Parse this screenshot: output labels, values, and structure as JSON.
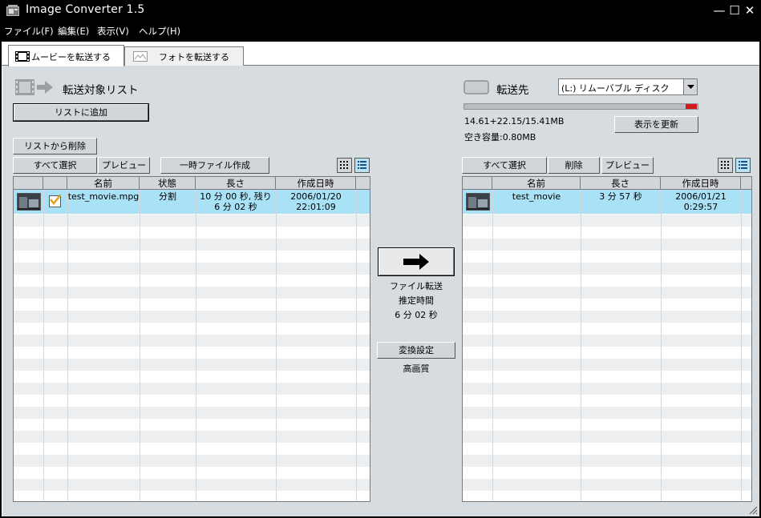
{
  "window": {
    "title": "Image Converter 1.5",
    "controls": {
      "minimize": "—",
      "maximize": "☐",
      "close": "✕"
    }
  },
  "menu": [
    "ファイル(F)",
    "編集(E)",
    "表示(V)",
    "ヘルプ(H)"
  ],
  "tabs": [
    {
      "label": "ムービーを転送する",
      "icon": "film-icon",
      "active": true
    },
    {
      "label": "フォトを転送する",
      "icon": "photo-icon",
      "active": false
    }
  ],
  "source": {
    "heading": "転送対象リスト",
    "add_button": "リストに追加",
    "remove_button": "リストから削除",
    "select_all_button": "すべて選択",
    "preview_button": "プレビュー",
    "temp_file_button": "一時ファイル作成",
    "columns": [
      "名前",
      "状態",
      "長さ",
      "作成日時"
    ],
    "rows": [
      {
        "name": "test_movie.mpg",
        "status": "分割",
        "length_line1": "10 分 00 秒, 残り",
        "length_line2": "6 分 02 秒",
        "date": "2006/01/20",
        "time": "22:01:09",
        "checked": true,
        "selected": true
      }
    ]
  },
  "transfer": {
    "label": "ファイル転送",
    "estimate_label": "推定時間",
    "estimate_value": "6 分 02 秒",
    "settings_button": "変換設定",
    "quality": "高画質"
  },
  "destination": {
    "heading": "転送先",
    "drive": "(L:) リムーバブル ディスク",
    "usage": "14.61+22.15/15.41MB",
    "free": "空き容量:0.80MB",
    "usage_fraction_used": 0.948,
    "usage_fraction_red": 0.052,
    "refresh_button": "表示を更新",
    "select_all_button": "すべて選択",
    "delete_button": "削除",
    "preview_button": "プレビュー",
    "columns": [
      "名前",
      "長さ",
      "作成日時"
    ],
    "rows": [
      {
        "name": "test_movie",
        "length": "3 分 57 秒",
        "date": "2006/01/21",
        "time": "0:29:57",
        "selected": true
      }
    ]
  },
  "colors": {
    "selection": "#a9e2f6",
    "panel": "#d7dce0",
    "capacity_warning": "#d21a1a"
  }
}
